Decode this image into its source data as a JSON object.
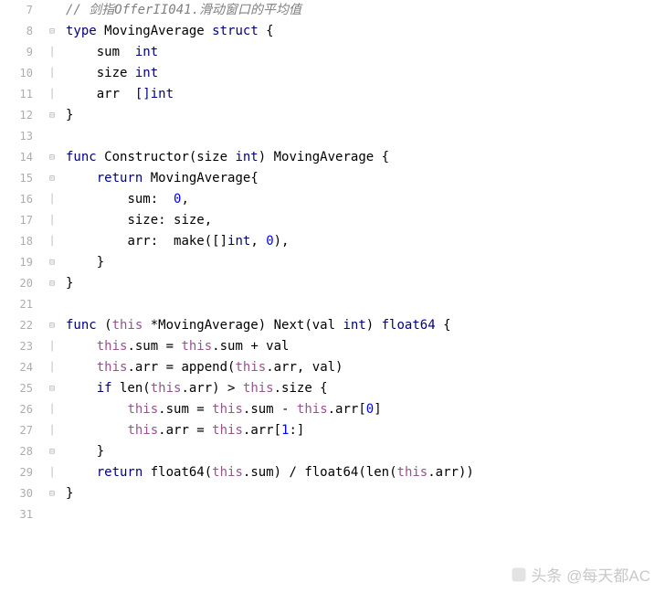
{
  "lines": {
    "start": 7,
    "count": 25
  },
  "code": {
    "l7_comment": "// 剑指OfferII041.滑动窗口的平均值",
    "l8_kw1": "type",
    "l8_name": "MovingAverage",
    "l8_kw2": "struct",
    "l8_brace": " {",
    "l9_field": "sum",
    "l9_type": "int",
    "l10_field": "size",
    "l10_type": "int",
    "l11_field": "arr",
    "l11_type": "[]int",
    "l12_brace": "}",
    "l14_kw": "func",
    "l14_fn": "Constructor",
    "l14_p1": "(size ",
    "l14_pt": "int",
    "l14_p2": ") ",
    "l14_ret": "MovingAverage",
    "l14_brace": " {",
    "l15_kw": "return",
    "l15_ty": " MovingAverage",
    "l15_brace": "{",
    "l16_k": "sum:  ",
    "l16_v": "0",
    "l16_c": ",",
    "l17_k": "size: ",
    "l17_v": "size",
    "l17_c": ",",
    "l18_k": "arr:  ",
    "l18_fn": "make",
    "l18_p1": "([]",
    "l18_ty": "int",
    "l18_p2": ", ",
    "l18_n": "0",
    "l18_p3": "),",
    "l19_brace": "}",
    "l20_brace": "}",
    "l22_kw": "func",
    "l22_recv1": " (",
    "l22_this": "this",
    "l22_recv2": " *MovingAverage) ",
    "l22_fn": "Next",
    "l22_p1": "(val ",
    "l22_pt": "int",
    "l22_p2": ") ",
    "l22_ret": "float64",
    "l22_brace": " {",
    "l23_this1": "this",
    "l23_t1": ".sum = ",
    "l23_this2": "this",
    "l23_t2": ".sum + val",
    "l24_this1": "this",
    "l24_t1": ".arr = ",
    "l24_fn": "append",
    "l24_p1": "(",
    "l24_this2": "this",
    "l24_t2": ".arr, val)",
    "l25_kw": "if",
    "l25_fn": " len",
    "l25_p1": "(",
    "l25_this": "this",
    "l25_t1": ".arr) > ",
    "l25_this2": "this",
    "l25_t2": ".size {",
    "l26_this1": "this",
    "l26_t1": ".sum = ",
    "l26_this2": "this",
    "l26_t2": ".sum - ",
    "l26_this3": "this",
    "l26_t3": ".arr[",
    "l26_n": "0",
    "l26_t4": "]",
    "l27_this1": "this",
    "l27_t1": ".arr = ",
    "l27_this2": "this",
    "l27_t2": ".arr[",
    "l27_n": "1",
    "l27_t3": ":]",
    "l28_brace": "}",
    "l29_kw": "return",
    "l29_fn1": " float64",
    "l29_p1": "(",
    "l29_this1": "this",
    "l29_t1": ".sum) / ",
    "l29_fn2": "float64",
    "l29_p2": "(",
    "l29_fn3": "len",
    "l29_p3": "(",
    "l29_this2": "this",
    "l29_t2": ".arr))",
    "l30_brace": "}"
  },
  "watermark": "头条 @每天都AC"
}
